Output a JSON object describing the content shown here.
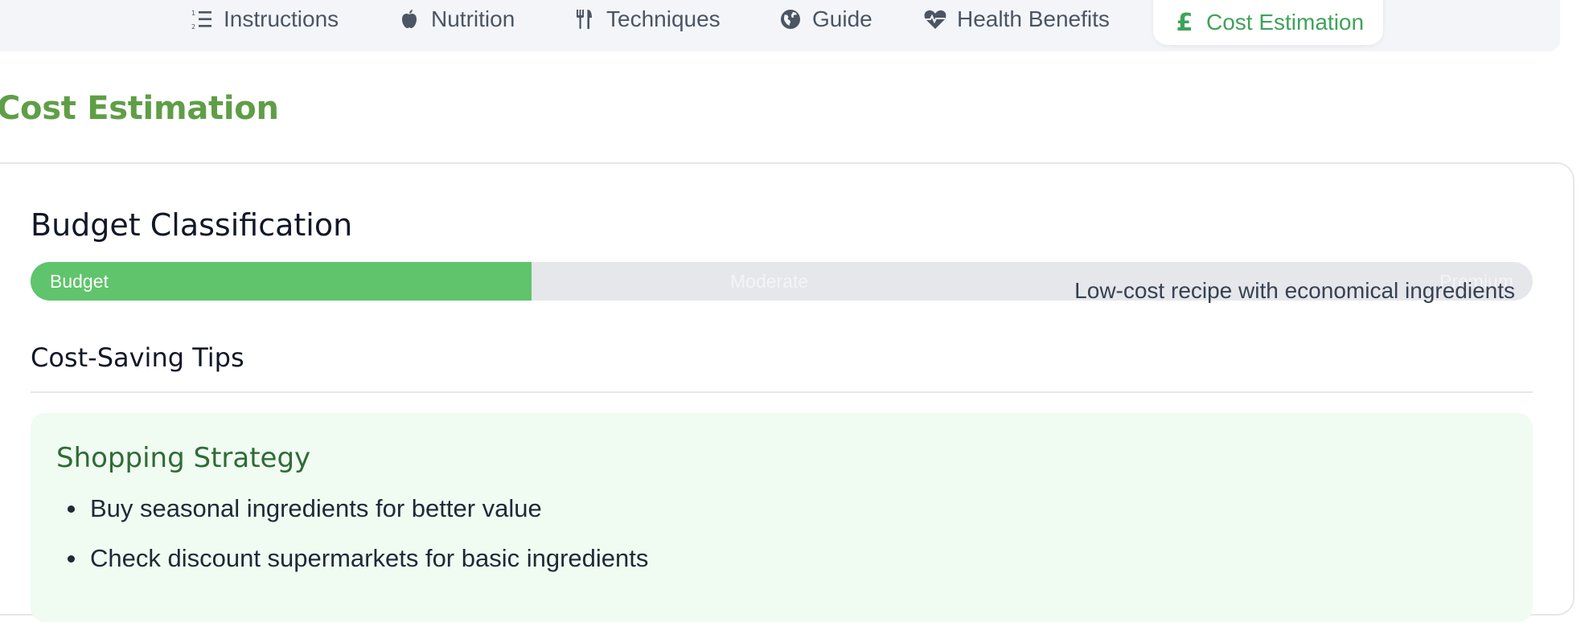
{
  "tabs": [
    {
      "label": "Instructions",
      "icon": "numbered-list-icon"
    },
    {
      "label": "Nutrition",
      "icon": "apple-icon"
    },
    {
      "label": "Techniques",
      "icon": "utensils-icon"
    },
    {
      "label": "Guide",
      "icon": "globe-icon"
    },
    {
      "label": "Health Benefits",
      "icon": "heartbeat-icon"
    },
    {
      "label": "Cost Estimation",
      "icon": "pound-icon",
      "active": true
    }
  ],
  "section": {
    "title": "Cost Estimation"
  },
  "budget": {
    "heading": "Budget Classification",
    "levels": [
      "Budget",
      "Moderate",
      "Premium"
    ],
    "selected": "Budget",
    "description": "Low-cost recipe with economical ingredients"
  },
  "tips": {
    "heading": "Cost-Saving Tips",
    "group_title": "Shopping Strategy",
    "items": [
      "Buy seasonal ingredients for better value",
      "Check discount supermarkets for basic ingredients"
    ]
  },
  "colors": {
    "accent": "#3fa35a",
    "title_green": "#5f9e47",
    "bar_fill": "#5fc46b",
    "tip_bg": "#f0fbf1"
  }
}
